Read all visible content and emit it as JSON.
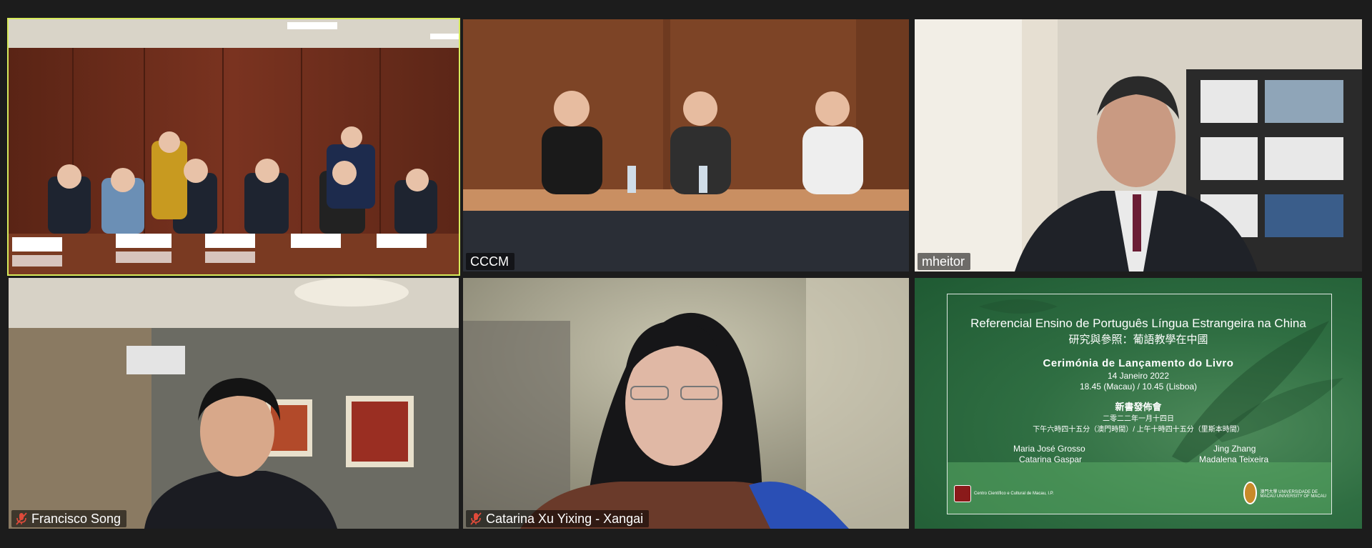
{
  "participants": [
    {
      "name": "",
      "muted": false,
      "active": true
    },
    {
      "name": "CCCM",
      "muted": false
    },
    {
      "name": "mheitor",
      "muted": false
    },
    {
      "name": "Francisco Song",
      "muted": true
    },
    {
      "name": "Catarina Xu Yixing - Xangai",
      "muted": true
    }
  ],
  "slide": {
    "title": "Referencial Ensino de Português Língua Estrangeira na China",
    "title_cn": "研究與參照：葡語教學在中國",
    "ceremony": "Cerimónia de Lançamento do Livro",
    "date": "14 Janeiro 2022",
    "time": "18.45 (Macau) / 10.45 (Lisboa)",
    "ceremony_cn": "新書發佈會",
    "date_cn": "二零二二年一月十四日",
    "time_cn": "下午六時四十五分（澳門時間）/ 上午十時四十五分（里斯本時間）",
    "authors_left": [
      "Maria José Grosso",
      "Catarina Gaspar"
    ],
    "authors_right": [
      "Jing Zhang",
      "Madalena Teixeira"
    ],
    "logo_left_text": "Centro Científico e Cultural de Macau, I.P.",
    "logo_right_text": "澳門大學 UNIVERSIDADE DE MACAU UNIVERSITY OF MACAU"
  },
  "colors": {
    "active_speaker_border": "#d6ea5b",
    "muted_icon": "#e04a3a",
    "slide_green": "#2f6e42"
  }
}
